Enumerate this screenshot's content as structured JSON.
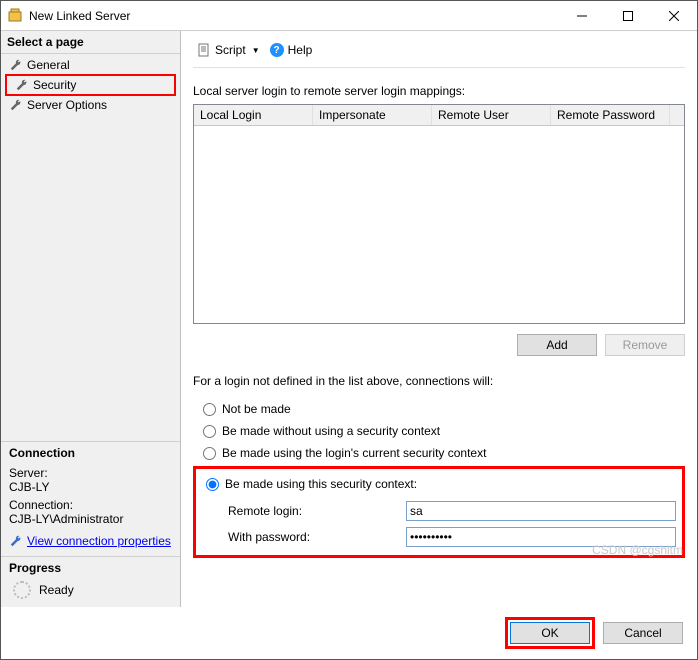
{
  "window": {
    "title": "New Linked Server"
  },
  "sidebar": {
    "select_page_header": "Select a page",
    "items": [
      {
        "label": "General"
      },
      {
        "label": "Security"
      },
      {
        "label": "Server Options"
      }
    ],
    "connection": {
      "header": "Connection",
      "server_label": "Server:",
      "server_value": "CJB-LY",
      "connection_label": "Connection:",
      "connection_value": "CJB-LY\\Administrator",
      "view_props": "View connection properties"
    },
    "progress": {
      "header": "Progress",
      "status": "Ready"
    }
  },
  "toolbar": {
    "script": "Script",
    "help": "Help"
  },
  "mappings": {
    "label": "Local server login to remote server login mappings:",
    "columns": [
      "Local Login",
      "Impersonate",
      "Remote User",
      "Remote Password"
    ],
    "add": "Add",
    "remove": "Remove"
  },
  "radios": {
    "caption": "For a login not defined in the list above, connections will:",
    "opt_not": "Not be made",
    "opt_no_ctx": "Be made without using a security context",
    "opt_login_ctx": "Be made using the login's current security context",
    "opt_this_ctx": "Be made using this security context:"
  },
  "fields": {
    "remote_login_label": "Remote login:",
    "remote_login_value": "sa",
    "with_password_label": "With password:",
    "with_password_value": "••••••••••"
  },
  "footer": {
    "ok": "OK",
    "cancel": "Cancel"
  },
  "watermark": "CSDN @cgshltm"
}
